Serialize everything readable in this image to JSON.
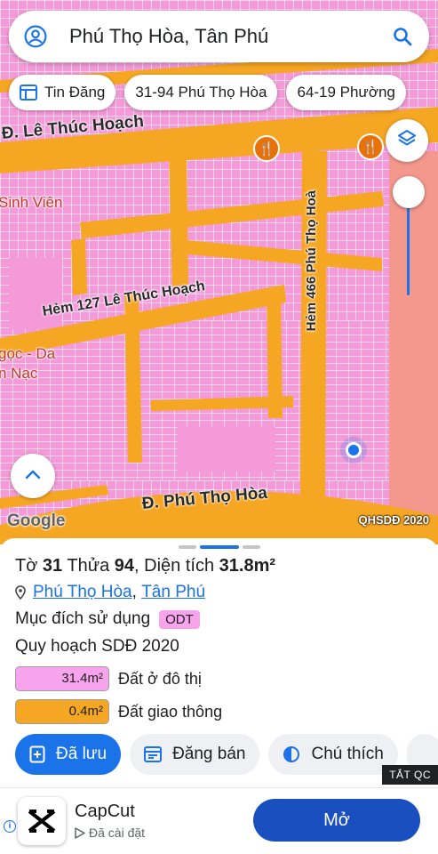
{
  "search": {
    "query": "Phú Thọ Hòa, Tân Phú"
  },
  "chips": [
    {
      "label": "Tin Đăng"
    },
    {
      "label": "31-94 Phú Thọ Hòa"
    },
    {
      "label": "64-19 Phường"
    }
  ],
  "map": {
    "labels": {
      "road1": "Đ. Lê Thúc Hoạch",
      "road2": "Hẻm 127 Lê Thúc Hoạch",
      "road3": "Hẻm 466 Phú Thọ Hoà",
      "road4": "Đ. Phú Thọ Hòa",
      "poi1": "Sinh Viên",
      "poi2": "gọc - Da\nn Nạc",
      "google": "Google",
      "credit": "QHSDĐ 2020"
    }
  },
  "parcel": {
    "to_label": "Tờ",
    "to": "31",
    "thua_label": "Thửa",
    "thua": "94",
    "area_label": ", Diện tích",
    "area": "31.8m²",
    "ward": "Phú Thọ Hòa",
    "sep": ",",
    "district": "Tân Phú",
    "purpose_label": "Mục đích sử dụng",
    "purpose_code": "ODT",
    "plan_label": "Quy hoạch SDĐ 2020",
    "legend": [
      {
        "value": "31.4m²",
        "label": "Đất ở đô thị",
        "color": "#f7a4ec"
      },
      {
        "value": "0.4m²",
        "label": "Đất giao thông",
        "color": "#f5a623"
      }
    ]
  },
  "actions": {
    "saved": "Đã lưu",
    "sell": "Đăng bán",
    "legend": "Chú thích"
  },
  "ad_flag": "TẮT QC",
  "ad": {
    "app_name": "CapCut",
    "status": "Đã cài đặt",
    "open": "Mở"
  }
}
